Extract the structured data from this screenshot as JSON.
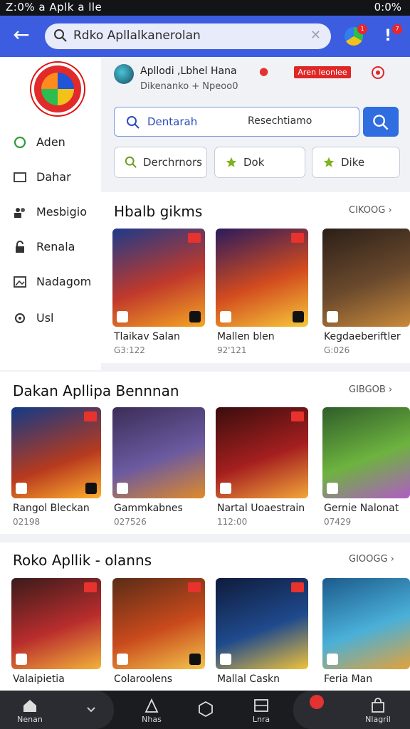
{
  "status_bar": {
    "left": "Z:0% a Aplk a lle",
    "right": "0:0%"
  },
  "app_bar": {
    "search_value": "Rdko Apllalkanerolan",
    "badge1": "1",
    "badge2": "7"
  },
  "sidebar": {
    "items": [
      {
        "label": "Aden",
        "icon": "home-icon"
      },
      {
        "label": "Dahar",
        "icon": "message-icon"
      },
      {
        "label": "Mesbigio",
        "icon": "users-icon"
      },
      {
        "label": "Renala",
        "icon": "lock-icon"
      },
      {
        "label": "Nadagom",
        "icon": "image-icon"
      },
      {
        "label": "Usl",
        "icon": "settings-icon"
      }
    ]
  },
  "profile": {
    "name": "Apllodi ,Lbhel Hana",
    "subtitle": "Dikenanko + Npeoo0",
    "button": "Aren leonlee"
  },
  "search2": {
    "field1": "Dentarah",
    "field2": "Resechtiamo"
  },
  "chips": [
    {
      "label": "Derchrnors",
      "icon": "search-icon"
    },
    {
      "label": "Dok",
      "icon": "star-icon"
    },
    {
      "label": "Dike",
      "icon": "star-icon"
    }
  ],
  "sections": [
    {
      "title": "Hbalb gikms",
      "more": "CIKOOG",
      "cards": [
        {
          "name": "Tlaikav Salan",
          "count": "G3:122",
          "colors": [
            "#1d3a8a",
            "#c0392b",
            "#f5a623"
          ]
        },
        {
          "name": "Mallen blen",
          "count": "92'121",
          "colors": [
            "#2a1b5e",
            "#d24b1e",
            "#f6c83a"
          ]
        },
        {
          "name": "Kegdaeberiftler",
          "count": "G:026",
          "colors": [
            "#2b1f18",
            "#6b4a2d",
            "#c98a3b"
          ]
        }
      ]
    },
    {
      "title": "Dakan Apllipa Bennnan",
      "more": "GIBGOB",
      "cards": [
        {
          "name": "Rangol Bleckan",
          "count": "02198",
          "colors": [
            "#123a86",
            "#b73a1e",
            "#ffb02e"
          ]
        },
        {
          "name": "Gammkabnes",
          "count": "027526",
          "colors": [
            "#3b2d57",
            "#6b5aa0",
            "#e08a2a"
          ]
        },
        {
          "name": "Nartal Uoaestrain",
          "count": "112:00",
          "colors": [
            "#3a0d0d",
            "#a51f1f",
            "#f2a63a"
          ]
        },
        {
          "name": "Gernie Nalonat",
          "count": "07429",
          "colors": [
            "#2f5d2a",
            "#6db33f",
            "#b05cc5"
          ]
        }
      ]
    },
    {
      "title": "Roko Apllik - olanns",
      "more": "GIOOGG",
      "cards": [
        {
          "name": "Valaipietia",
          "count": "",
          "colors": [
            "#3a1b1b",
            "#b92d2d",
            "#f3b33a"
          ]
        },
        {
          "name": "Colaroolens",
          "count": "",
          "colors": [
            "#5a2c17",
            "#c94a1c",
            "#f3c54c"
          ]
        },
        {
          "name": "Mallal Caskn",
          "count": "",
          "colors": [
            "#0f1b3c",
            "#1f4a8c",
            "#f0c23a"
          ]
        },
        {
          "name": "Feria Man",
          "count": "",
          "colors": [
            "#1c5a8c",
            "#4ab0d8",
            "#e3a23a"
          ]
        }
      ]
    }
  ],
  "bottom_nav": [
    {
      "label": "Nenan",
      "icon": "home-icon"
    },
    {
      "label": "",
      "icon": "chevron-down-icon"
    },
    {
      "label": "Nhas",
      "icon": "tent-icon"
    },
    {
      "label": "",
      "icon": "hexagon-icon"
    },
    {
      "label": "Lnra",
      "icon": "grid-icon"
    },
    {
      "label": "",
      "icon": "notification-icon"
    },
    {
      "label": "Nlagril",
      "icon": "bag-icon"
    }
  ]
}
